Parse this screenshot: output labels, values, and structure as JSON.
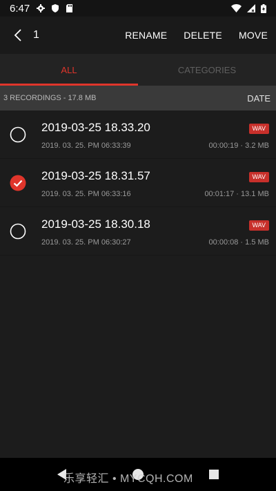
{
  "status_bar": {
    "time": "6:47",
    "icons": [
      "gear-icon",
      "shield-icon",
      "sd-card-icon",
      "wifi-icon",
      "signal-icon",
      "battery-icon"
    ]
  },
  "header": {
    "selected_count": "1",
    "actions": {
      "rename": "RENAME",
      "delete": "DELETE",
      "move": "MOVE"
    }
  },
  "tabs": {
    "all": "ALL",
    "categories": "CATEGORIES",
    "active": "ALL"
  },
  "summary": {
    "text": "3 RECORDINGS - 17.8 MB",
    "sort_label": "DATE"
  },
  "recordings": [
    {
      "title": "2019-03-25 18.33.20",
      "format": "WAV",
      "date": "2019. 03. 25. PM 06:33:39",
      "meta": "00:00:19 · 3.2 MB",
      "checked": false
    },
    {
      "title": "2019-03-25 18.31.57",
      "format": "WAV",
      "date": "2019. 03. 25. PM 06:33:16",
      "meta": "00:01:17 · 13.1 MB",
      "checked": true
    },
    {
      "title": "2019-03-25 18.30.18",
      "format": "WAV",
      "date": "2019. 03. 25. PM 06:30:27",
      "meta": "00:00:08 · 1.5 MB",
      "checked": false
    }
  ],
  "watermark": "乐享轻汇 • MYCQH.COM",
  "colors": {
    "accent": "#e0352b",
    "badge": "#c8302b",
    "background": "#1c1c1c",
    "summary_bg": "#3a3a3a"
  }
}
